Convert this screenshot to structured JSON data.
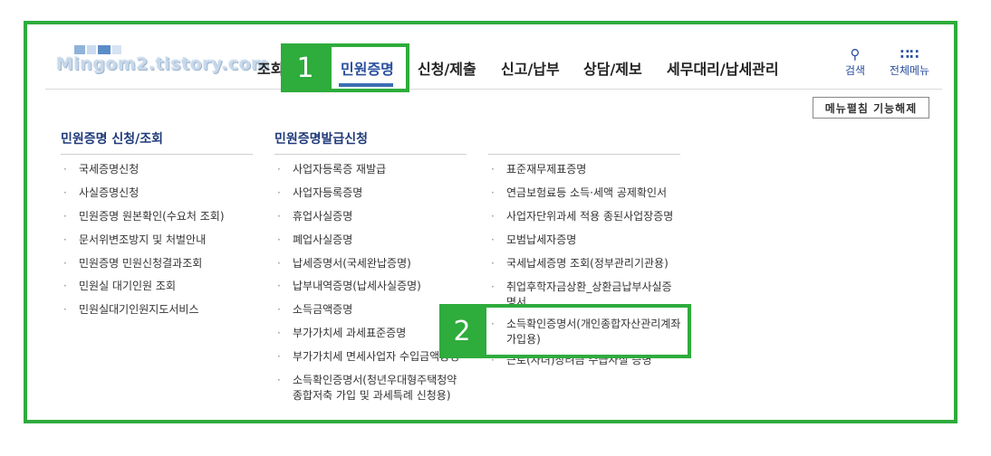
{
  "logo": {
    "text": "Mingom2.tistory.com"
  },
  "nav": {
    "items": [
      {
        "label": "조회"
      },
      {
        "label": "민원증명"
      },
      {
        "label": "신청/제출"
      },
      {
        "label": "신고/납부"
      },
      {
        "label": "상담/제보"
      },
      {
        "label": "세무대리/납세관리"
      }
    ],
    "active_index": 1
  },
  "tools": {
    "search": {
      "label": "검색",
      "icon": "search-icon"
    },
    "all_menu": {
      "label": "전체메뉴",
      "icon": "grid-icon"
    }
  },
  "menu_close_button": "메뉴펼침 기능해제",
  "columns": [
    {
      "title": "민원증명 신청/조회",
      "items": [
        "국세증명신청",
        "사실증명신청",
        "민원증명 원본확인(수요처 조회)",
        "문서위변조방지 및 처벌안내",
        "민원증명 민원신청결과조회",
        "민원실 대기인원 조회",
        "민원실대기인원지도서비스"
      ]
    },
    {
      "title": "민원증명발급신청",
      "items": [
        "사업자등록증 재발급",
        "사업자등록증명",
        "휴업사실증명",
        "폐업사실증명",
        "납세증명서(국세완납증명)",
        "납부내역증명(납세사실증명)",
        "소득금액증명",
        "부가가치세 과세표준증명",
        "부가가치세 면세사업자 수입금액증명",
        "소득확인증명서(청년우대형주택청약종합저축 가입 및 과세특례 신청용)"
      ]
    },
    {
      "title": "",
      "items": [
        "표준재무제표증명",
        "연금보험료등 소득·세액 공제확인서",
        "사업자단위과세 적용 종된사업장증명",
        "모범납세자증명",
        "국세납세증명 조회(정부관리기관용)",
        "취업후학자금상환_상환금납부사실증명서",
        "소득확인증명서(개인종합자산관리계좌 가입용)",
        "근로(자녀)장려금 수급사실 증명"
      ]
    }
  ],
  "steps": [
    "1",
    "2"
  ],
  "colors": {
    "accent_green": "#2eac3c",
    "nav_blue": "#2a4fa0",
    "title_blue": "#1f3a7a"
  }
}
